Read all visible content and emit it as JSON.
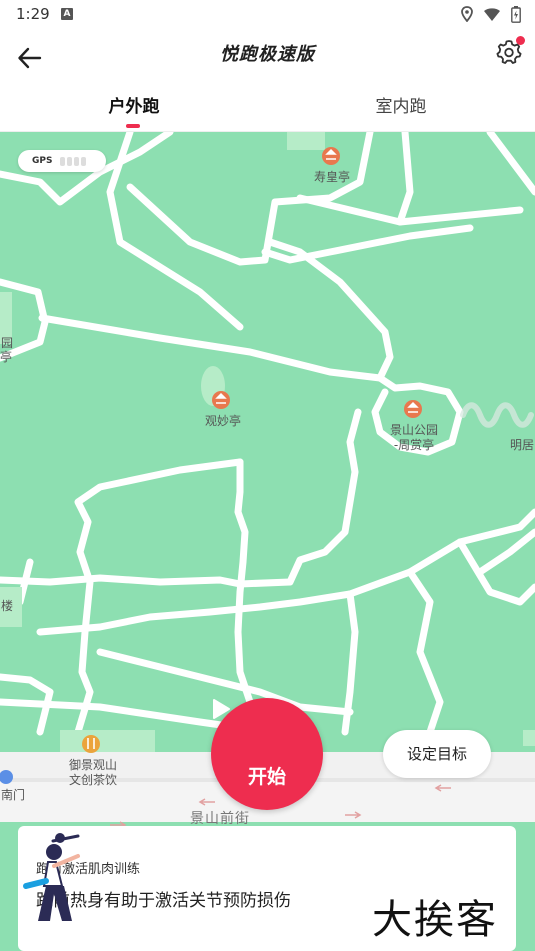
{
  "status_bar": {
    "time": "1:29",
    "notification_badge": "A",
    "icons": [
      "location-icon",
      "wifi-icon",
      "battery-icon"
    ]
  },
  "header": {
    "title": "悦跑极速版",
    "back_icon": "arrow-left-icon",
    "settings_icon": "gear-icon",
    "settings_badge_color": "#ee2d4f"
  },
  "tabs": [
    {
      "label": "户外跑",
      "active": true
    },
    {
      "label": "室内跑",
      "active": false
    }
  ],
  "accent_color": "#ee2d4f",
  "map": {
    "background_color": "#8ddfb1",
    "gps_label": "GPS",
    "gps_signal_bars": 0,
    "labels": {
      "shouhuang": "寿皇亭",
      "guanmiao": "观妙亭",
      "jingshan_line1": "景山公园",
      "jingshan_line2": "-周赏亭",
      "mingjing": "明居",
      "yuan": "园",
      "ting": "亭",
      "lou": "楼",
      "teahouse_line1": "御景观山",
      "teahouse_line2": "文创茶饮",
      "men": "南门",
      "street": "景山前街"
    }
  },
  "start_button": {
    "label": "开始",
    "icon": "play-icon"
  },
  "goal_button": {
    "label": "设定目标"
  },
  "warmup_card": {
    "title": "跑前激活肌肉训练",
    "description": "跑前热身有助于激活关节预防损伤"
  },
  "watermark": "大挨客"
}
